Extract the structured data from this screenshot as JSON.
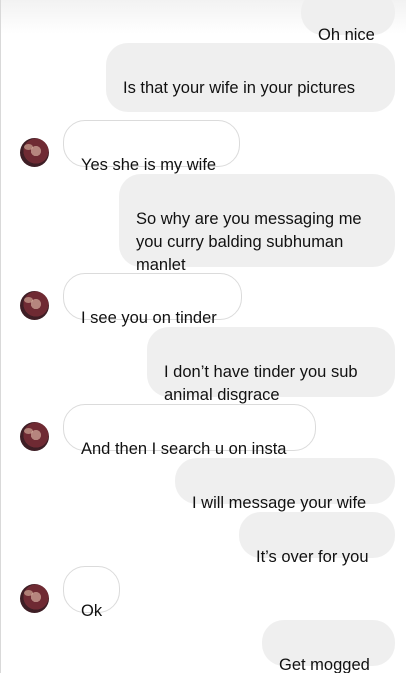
{
  "conversation": {
    "messages": [
      {
        "side": "sent",
        "text": "Oh nice"
      },
      {
        "side": "sent",
        "text": "Is that your wife in your pictures",
        "emoji": "🙈"
      },
      {
        "side": "received",
        "text": "Yes she is my wife"
      },
      {
        "side": "sent",
        "text": "So why are you messaging me\nyou curry balding subhuman\nmanlet"
      },
      {
        "side": "received",
        "text": "I see you on tinder"
      },
      {
        "side": "sent",
        "text": "I don’t have tinder you sub\nanimal disgrace"
      },
      {
        "side": "received",
        "text": "And then I search u on insta"
      },
      {
        "side": "sent",
        "text": "I will message your wife"
      },
      {
        "side": "sent",
        "text": "It’s over for you"
      },
      {
        "side": "received",
        "text": "Ok"
      },
      {
        "side": "sent",
        "text": "Get mogged"
      }
    ]
  },
  "colors": {
    "sent_bubble": "#efefef",
    "received_bubble": "#ffffff",
    "received_border": "#dbdbdb",
    "text": "#111111"
  }
}
